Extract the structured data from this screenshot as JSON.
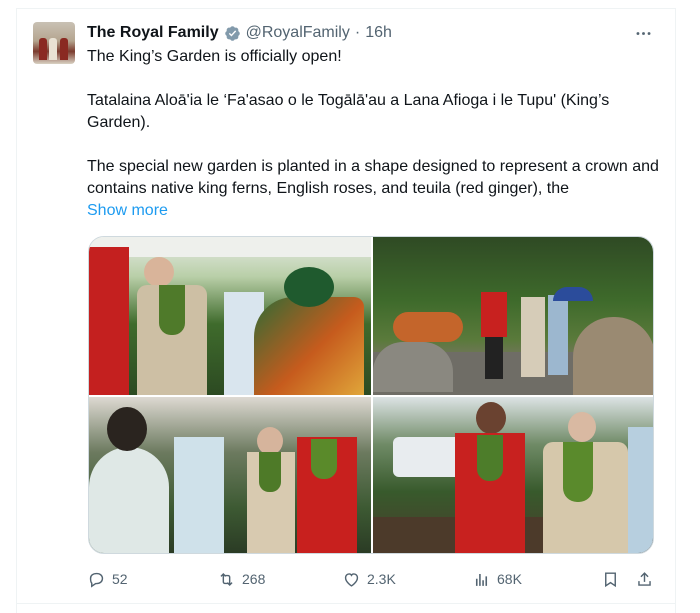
{
  "tweet": {
    "display_name": "The Royal Family",
    "handle": "@RoyalFamily",
    "separator": "·",
    "time": "16h",
    "text_line1": "The King’s Garden is officially open!",
    "text_para2": "Tatalaina Aloā'ia le ‘Fa'asao o le Togālā'au a Lana Afioga i le Tupu' (King’s Garden).",
    "text_para3": "The special new garden is planted in a shape designed to represent a crown and contains native king ferns, English roses, and teuila (red ginger), the",
    "show_more": "Show more"
  },
  "icons": {
    "verified": "verified-badge-icon",
    "more": "more-options-icon",
    "reply": "reply-icon",
    "repost": "repost-icon",
    "like": "heart-icon",
    "views": "views-chart-icon",
    "bookmark": "bookmark-icon",
    "share": "share-icon"
  },
  "media": [
    {
      "label": "photo-1"
    },
    {
      "label": "photo-2"
    },
    {
      "label": "photo-3"
    },
    {
      "label": "photo-4"
    }
  ],
  "actions": {
    "replies": "52",
    "reposts": "268",
    "likes": "2.3K",
    "views": "68K"
  },
  "colors": {
    "link": "#1d9bf0",
    "secondary_text": "#536471",
    "verified_badge": "#829aab"
  }
}
